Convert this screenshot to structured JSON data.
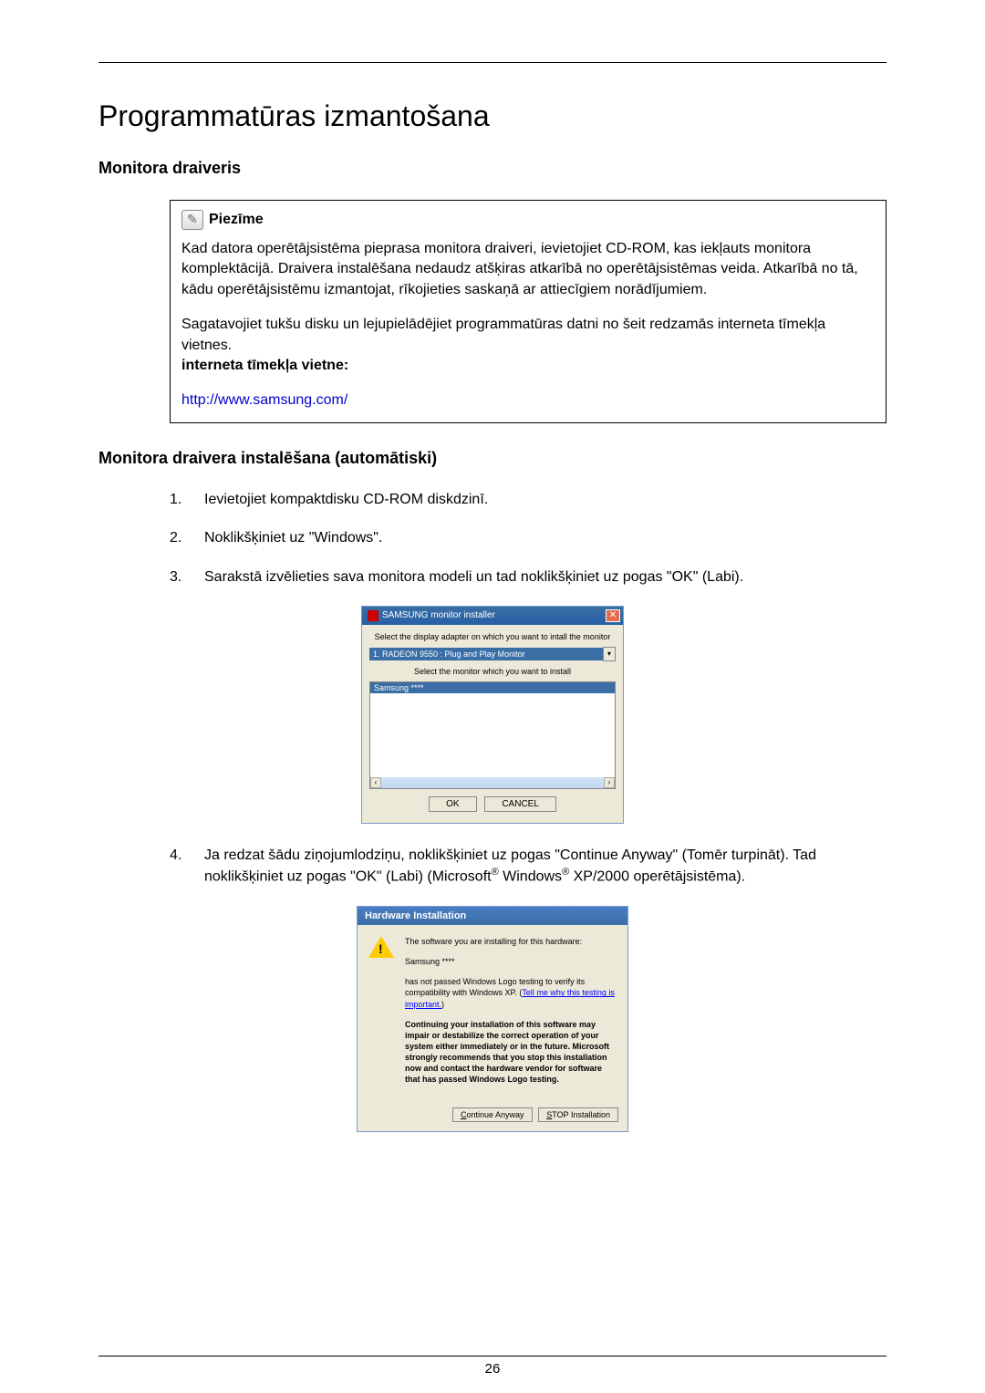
{
  "page": {
    "title": "Programmatūras izmantošana",
    "page_number": "26"
  },
  "section1": {
    "title": "Monitora draiveris"
  },
  "note": {
    "label": "Piezīme",
    "p1": "Kad datora operētājsistēma pieprasa monitora draiveri, ievietojiet CD-ROM, kas iekļauts monitora komplektācijā. Draivera instalēšana nedaudz atšķiras atkarībā no operētājsistēmas veida. Atkarībā no tā, kādu operētājsistēmu izmantojat, rīkojieties saskaņā ar attiecīgiem norādījumiem.",
    "p2": "Sagatavojiet tukšu disku un lejupielādējiet programmatūras datni no šeit redzamās interneta tīmekļa vietnes.",
    "p2_bold": "interneta tīmekļa vietne:",
    "url": "http://www.samsung.com/"
  },
  "section2": {
    "title": "Monitora draivera instalēšana (automātiski)"
  },
  "list": {
    "item1_num": "1.",
    "item1_text": "Ievietojiet kompaktdisku CD-ROM diskdzinī.",
    "item2_num": "2.",
    "item2_text": "Noklikšķiniet uz \"Windows\".",
    "item3_num": "3.",
    "item3_text": "Sarakstā izvēlieties sava monitora modeli un tad noklikšķiniet uz pogas \"OK\" (Labi).",
    "item4_num": "4.",
    "item4_text_a": "Ja redzat šādu ziņojumlodziņu, noklikšķiniet uz pogas \"Continue Anyway\" (Tomēr turpināt). Tad noklikšķiniet uz pogas \"OK\" (Labi) (Microsoft",
    "item4_text_b": " Windows",
    "item4_text_c": " XP/2000 operētājsistēma)."
  },
  "dialog_installer": {
    "title": "SAMSUNG monitor installer",
    "instr1": "Select the display adapter on which you want to intall the monitor",
    "adapter": "1. RADEON 9550 : Plug and Play Monitor",
    "instr2": "Select the monitor which you want to install",
    "monitor": "Samsung ****",
    "ok": "OK",
    "cancel": "CANCEL"
  },
  "dialog_hardware": {
    "title": "Hardware Installation",
    "p1": "The software you are installing for this hardware:",
    "p2": "Samsung ****",
    "p3_a": "has not passed Windows Logo testing to verify its compatibility with Windows XP. (",
    "p3_link": "Tell me why this testing is important.",
    "p3_b": ")",
    "p4": "Continuing your installation of this software may impair or destabilize the correct operation of your system either immediately or in the future. Microsoft strongly recommends that you stop this installation now and contact the hardware vendor for software that has passed Windows Logo testing.",
    "continue": "ontinue Anyway",
    "continue_u": "C",
    "stop": "TOP Installation",
    "stop_u": "S"
  }
}
